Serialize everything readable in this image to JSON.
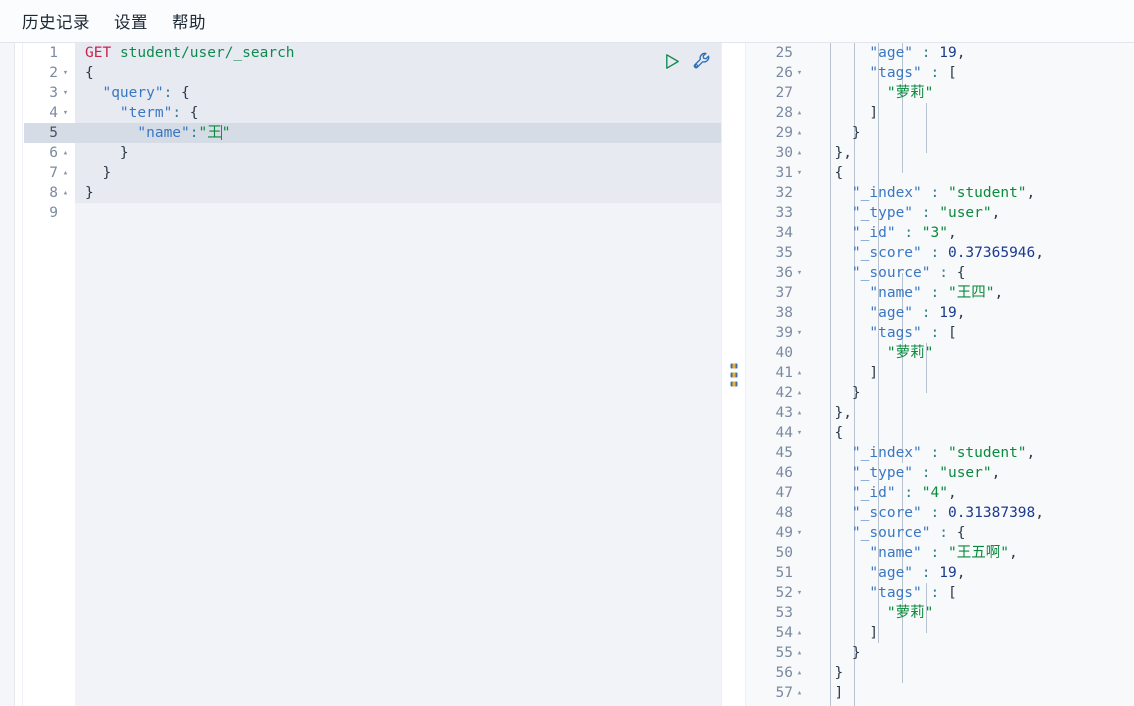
{
  "menubar": {
    "items": [
      {
        "label": "历史记录",
        "name": "menu-history"
      },
      {
        "label": "设置",
        "name": "menu-settings"
      },
      {
        "label": "帮助",
        "name": "menu-help"
      }
    ]
  },
  "editor": {
    "actions": [
      {
        "name": "run-request-button",
        "icon": "play-icon",
        "color": "#0f8a4f",
        "title": "发送请求"
      },
      {
        "name": "wrench-menu-button",
        "icon": "wrench-icon",
        "color": "#2f6fb5",
        "title": "操作菜单"
      }
    ],
    "active_line": 5,
    "request": {
      "method": "GET",
      "path": "student/user/_search",
      "query_field": "query",
      "term_field": "term",
      "name_field": "name",
      "name_value": "王"
    },
    "lines": [
      {
        "no": 1,
        "fold": "",
        "active": false,
        "lit": true,
        "tokens": [
          {
            "c": "t-method",
            "t": "GET"
          },
          {
            "c": "t-punc",
            "t": " "
          },
          {
            "c": "t-url",
            "t": "student/user/_search"
          }
        ]
      },
      {
        "no": 2,
        "fold": "▾",
        "active": false,
        "lit": true,
        "tokens": [
          {
            "c": "t-brace",
            "t": "{"
          }
        ]
      },
      {
        "no": 3,
        "fold": "▾",
        "active": false,
        "lit": true,
        "tokens": [
          {
            "c": "t-punc",
            "t": "  "
          },
          {
            "c": "t-key",
            "t": "\"query\""
          },
          {
            "c": "t-colon",
            "t": ":"
          },
          {
            "c": "t-punc",
            "t": " "
          },
          {
            "c": "t-brace",
            "t": "{"
          }
        ]
      },
      {
        "no": 4,
        "fold": "▾",
        "active": false,
        "lit": true,
        "tokens": [
          {
            "c": "t-punc",
            "t": "    "
          },
          {
            "c": "t-key",
            "t": "\"term\""
          },
          {
            "c": "t-colon",
            "t": ":"
          },
          {
            "c": "t-punc",
            "t": " "
          },
          {
            "c": "t-brace",
            "t": "{"
          }
        ]
      },
      {
        "no": 5,
        "fold": "",
        "active": true,
        "lit": true,
        "caret_after": true,
        "tokens": [
          {
            "c": "t-punc",
            "t": "      "
          },
          {
            "c": "t-key",
            "t": "\"name\""
          },
          {
            "c": "t-colon",
            "t": ":"
          },
          {
            "c": "t-str",
            "t": "\"王"
          }
        ]
      },
      {
        "no": 6,
        "fold": "▴",
        "active": false,
        "lit": true,
        "tokens": [
          {
            "c": "t-punc",
            "t": "    "
          },
          {
            "c": "t-brace",
            "t": "}"
          }
        ]
      },
      {
        "no": 7,
        "fold": "▴",
        "active": false,
        "lit": true,
        "tokens": [
          {
            "c": "t-punc",
            "t": "  "
          },
          {
            "c": "t-brace",
            "t": "}"
          }
        ]
      },
      {
        "no": 8,
        "fold": "▴",
        "active": false,
        "lit": true,
        "tokens": [
          {
            "c": "t-brace",
            "t": "}"
          }
        ]
      },
      {
        "no": 9,
        "fold": "",
        "active": false,
        "lit": false,
        "tokens": []
      }
    ]
  },
  "splitter": {
    "name": "panel-splitter",
    "handle": "drag-handle-icon"
  },
  "response": {
    "first_line": 25,
    "hits": [
      {
        "_index": "student",
        "_type": "user",
        "_id": "3",
        "_score": 0.37365946,
        "_source": {
          "name": "王四",
          "age": 19,
          "tags": [
            "萝莉"
          ]
        }
      },
      {
        "_index": "student",
        "_type": "user",
        "_id": "4",
        "_score": 0.31387398,
        "_source": {
          "name": "王五啊",
          "age": 19,
          "tags": [
            "萝莉"
          ]
        }
      }
    ],
    "lines": [
      {
        "no": 25,
        "fold": "",
        "tokens": [
          {
            "c": "t-punc",
            "t": "      "
          },
          {
            "c": "t-key",
            "t": "\"age\""
          },
          {
            "c": "t-punc",
            "t": " "
          },
          {
            "c": "t-colon",
            "t": ":"
          },
          {
            "c": "t-punc",
            "t": " "
          },
          {
            "c": "t-num",
            "t": "19"
          },
          {
            "c": "t-punc",
            "t": ","
          }
        ]
      },
      {
        "no": 26,
        "fold": "▾",
        "tokens": [
          {
            "c": "t-punc",
            "t": "      "
          },
          {
            "c": "t-key",
            "t": "\"tags\""
          },
          {
            "c": "t-punc",
            "t": " "
          },
          {
            "c": "t-colon",
            "t": ":"
          },
          {
            "c": "t-punc",
            "t": " "
          },
          {
            "c": "t-brace",
            "t": "["
          }
        ]
      },
      {
        "no": 27,
        "fold": "",
        "tokens": [
          {
            "c": "t-punc",
            "t": "        "
          },
          {
            "c": "t-str",
            "t": "\"萝莉\""
          }
        ]
      },
      {
        "no": 28,
        "fold": "▴",
        "tokens": [
          {
            "c": "t-punc",
            "t": "      "
          },
          {
            "c": "t-brace",
            "t": "]"
          }
        ]
      },
      {
        "no": 29,
        "fold": "▴",
        "tokens": [
          {
            "c": "t-punc",
            "t": "    "
          },
          {
            "c": "t-brace",
            "t": "}"
          }
        ]
      },
      {
        "no": 30,
        "fold": "▴",
        "tokens": [
          {
            "c": "t-punc",
            "t": "  "
          },
          {
            "c": "t-brace",
            "t": "}"
          },
          {
            "c": "t-punc",
            "t": ","
          }
        ]
      },
      {
        "no": 31,
        "fold": "▾",
        "tokens": [
          {
            "c": "t-punc",
            "t": "  "
          },
          {
            "c": "t-brace",
            "t": "{"
          }
        ]
      },
      {
        "no": 32,
        "fold": "",
        "tokens": [
          {
            "c": "t-punc",
            "t": "    "
          },
          {
            "c": "t-key",
            "t": "\"_index\""
          },
          {
            "c": "t-punc",
            "t": " "
          },
          {
            "c": "t-colon",
            "t": ":"
          },
          {
            "c": "t-punc",
            "t": " "
          },
          {
            "c": "t-str",
            "t": "\"student\""
          },
          {
            "c": "t-punc",
            "t": ","
          }
        ]
      },
      {
        "no": 33,
        "fold": "",
        "tokens": [
          {
            "c": "t-punc",
            "t": "    "
          },
          {
            "c": "t-key",
            "t": "\"_type\""
          },
          {
            "c": "t-punc",
            "t": " "
          },
          {
            "c": "t-colon",
            "t": ":"
          },
          {
            "c": "t-punc",
            "t": " "
          },
          {
            "c": "t-str",
            "t": "\"user\""
          },
          {
            "c": "t-punc",
            "t": ","
          }
        ]
      },
      {
        "no": 34,
        "fold": "",
        "tokens": [
          {
            "c": "t-punc",
            "t": "    "
          },
          {
            "c": "t-key",
            "t": "\"_id\""
          },
          {
            "c": "t-punc",
            "t": " "
          },
          {
            "c": "t-colon",
            "t": ":"
          },
          {
            "c": "t-punc",
            "t": " "
          },
          {
            "c": "t-str",
            "t": "\"3\""
          },
          {
            "c": "t-punc",
            "t": ","
          }
        ]
      },
      {
        "no": 35,
        "fold": "",
        "tokens": [
          {
            "c": "t-punc",
            "t": "    "
          },
          {
            "c": "t-key",
            "t": "\"_score\""
          },
          {
            "c": "t-punc",
            "t": " "
          },
          {
            "c": "t-colon",
            "t": ":"
          },
          {
            "c": "t-punc",
            "t": " "
          },
          {
            "c": "t-num",
            "t": "0.37365946"
          },
          {
            "c": "t-punc",
            "t": ","
          }
        ]
      },
      {
        "no": 36,
        "fold": "▾",
        "tokens": [
          {
            "c": "t-punc",
            "t": "    "
          },
          {
            "c": "t-key",
            "t": "\"_source\""
          },
          {
            "c": "t-punc",
            "t": " "
          },
          {
            "c": "t-colon",
            "t": ":"
          },
          {
            "c": "t-punc",
            "t": " "
          },
          {
            "c": "t-brace",
            "t": "{"
          }
        ]
      },
      {
        "no": 37,
        "fold": "",
        "tokens": [
          {
            "c": "t-punc",
            "t": "      "
          },
          {
            "c": "t-key",
            "t": "\"name\""
          },
          {
            "c": "t-punc",
            "t": " "
          },
          {
            "c": "t-colon",
            "t": ":"
          },
          {
            "c": "t-punc",
            "t": " "
          },
          {
            "c": "t-str",
            "t": "\"王四\""
          },
          {
            "c": "t-punc",
            "t": ","
          }
        ]
      },
      {
        "no": 38,
        "fold": "",
        "tokens": [
          {
            "c": "t-punc",
            "t": "      "
          },
          {
            "c": "t-key",
            "t": "\"age\""
          },
          {
            "c": "t-punc",
            "t": " "
          },
          {
            "c": "t-colon",
            "t": ":"
          },
          {
            "c": "t-punc",
            "t": " "
          },
          {
            "c": "t-num",
            "t": "19"
          },
          {
            "c": "t-punc",
            "t": ","
          }
        ]
      },
      {
        "no": 39,
        "fold": "▾",
        "tokens": [
          {
            "c": "t-punc",
            "t": "      "
          },
          {
            "c": "t-key",
            "t": "\"tags\""
          },
          {
            "c": "t-punc",
            "t": " "
          },
          {
            "c": "t-colon",
            "t": ":"
          },
          {
            "c": "t-punc",
            "t": " "
          },
          {
            "c": "t-brace",
            "t": "["
          }
        ]
      },
      {
        "no": 40,
        "fold": "",
        "tokens": [
          {
            "c": "t-punc",
            "t": "        "
          },
          {
            "c": "t-str",
            "t": "\"萝莉\""
          }
        ]
      },
      {
        "no": 41,
        "fold": "▴",
        "tokens": [
          {
            "c": "t-punc",
            "t": "      "
          },
          {
            "c": "t-brace",
            "t": "]"
          }
        ]
      },
      {
        "no": 42,
        "fold": "▴",
        "tokens": [
          {
            "c": "t-punc",
            "t": "    "
          },
          {
            "c": "t-brace",
            "t": "}"
          }
        ]
      },
      {
        "no": 43,
        "fold": "▴",
        "tokens": [
          {
            "c": "t-punc",
            "t": "  "
          },
          {
            "c": "t-brace",
            "t": "}"
          },
          {
            "c": "t-punc",
            "t": ","
          }
        ]
      },
      {
        "no": 44,
        "fold": "▾",
        "tokens": [
          {
            "c": "t-punc",
            "t": "  "
          },
          {
            "c": "t-brace",
            "t": "{"
          }
        ]
      },
      {
        "no": 45,
        "fold": "",
        "tokens": [
          {
            "c": "t-punc",
            "t": "    "
          },
          {
            "c": "t-key",
            "t": "\"_index\""
          },
          {
            "c": "t-punc",
            "t": " "
          },
          {
            "c": "t-colon",
            "t": ":"
          },
          {
            "c": "t-punc",
            "t": " "
          },
          {
            "c": "t-str",
            "t": "\"student\""
          },
          {
            "c": "t-punc",
            "t": ","
          }
        ]
      },
      {
        "no": 46,
        "fold": "",
        "tokens": [
          {
            "c": "t-punc",
            "t": "    "
          },
          {
            "c": "t-key",
            "t": "\"_type\""
          },
          {
            "c": "t-punc",
            "t": " "
          },
          {
            "c": "t-colon",
            "t": ":"
          },
          {
            "c": "t-punc",
            "t": " "
          },
          {
            "c": "t-str",
            "t": "\"user\""
          },
          {
            "c": "t-punc",
            "t": ","
          }
        ]
      },
      {
        "no": 47,
        "fold": "",
        "tokens": [
          {
            "c": "t-punc",
            "t": "    "
          },
          {
            "c": "t-key",
            "t": "\"_id\""
          },
          {
            "c": "t-punc",
            "t": " "
          },
          {
            "c": "t-colon",
            "t": ":"
          },
          {
            "c": "t-punc",
            "t": " "
          },
          {
            "c": "t-str",
            "t": "\"4\""
          },
          {
            "c": "t-punc",
            "t": ","
          }
        ]
      },
      {
        "no": 48,
        "fold": "",
        "tokens": [
          {
            "c": "t-punc",
            "t": "    "
          },
          {
            "c": "t-key",
            "t": "\"_score\""
          },
          {
            "c": "t-punc",
            "t": " "
          },
          {
            "c": "t-colon",
            "t": ":"
          },
          {
            "c": "t-punc",
            "t": " "
          },
          {
            "c": "t-num",
            "t": "0.31387398"
          },
          {
            "c": "t-punc",
            "t": ","
          }
        ]
      },
      {
        "no": 49,
        "fold": "▾",
        "tokens": [
          {
            "c": "t-punc",
            "t": "    "
          },
          {
            "c": "t-key",
            "t": "\"_source\""
          },
          {
            "c": "t-punc",
            "t": " "
          },
          {
            "c": "t-colon",
            "t": ":"
          },
          {
            "c": "t-punc",
            "t": " "
          },
          {
            "c": "t-brace",
            "t": "{"
          }
        ]
      },
      {
        "no": 50,
        "fold": "",
        "tokens": [
          {
            "c": "t-punc",
            "t": "      "
          },
          {
            "c": "t-key",
            "t": "\"name\""
          },
          {
            "c": "t-punc",
            "t": " "
          },
          {
            "c": "t-colon",
            "t": ":"
          },
          {
            "c": "t-punc",
            "t": " "
          },
          {
            "c": "t-str",
            "t": "\"王五啊\""
          },
          {
            "c": "t-punc",
            "t": ","
          }
        ]
      },
      {
        "no": 51,
        "fold": "",
        "tokens": [
          {
            "c": "t-punc",
            "t": "      "
          },
          {
            "c": "t-key",
            "t": "\"age\""
          },
          {
            "c": "t-punc",
            "t": " "
          },
          {
            "c": "t-colon",
            "t": ":"
          },
          {
            "c": "t-punc",
            "t": " "
          },
          {
            "c": "t-num",
            "t": "19"
          },
          {
            "c": "t-punc",
            "t": ","
          }
        ]
      },
      {
        "no": 52,
        "fold": "▾",
        "tokens": [
          {
            "c": "t-punc",
            "t": "      "
          },
          {
            "c": "t-key",
            "t": "\"tags\""
          },
          {
            "c": "t-punc",
            "t": " "
          },
          {
            "c": "t-colon",
            "t": ":"
          },
          {
            "c": "t-punc",
            "t": " "
          },
          {
            "c": "t-brace",
            "t": "["
          }
        ]
      },
      {
        "no": 53,
        "fold": "",
        "tokens": [
          {
            "c": "t-punc",
            "t": "        "
          },
          {
            "c": "t-str",
            "t": "\"萝莉\""
          }
        ]
      },
      {
        "no": 54,
        "fold": "▴",
        "tokens": [
          {
            "c": "t-punc",
            "t": "      "
          },
          {
            "c": "t-brace",
            "t": "]"
          }
        ]
      },
      {
        "no": 55,
        "fold": "▴",
        "tokens": [
          {
            "c": "t-punc",
            "t": "    "
          },
          {
            "c": "t-brace",
            "t": "}"
          }
        ]
      },
      {
        "no": 56,
        "fold": "▴",
        "tokens": [
          {
            "c": "t-punc",
            "t": "  "
          },
          {
            "c": "t-brace",
            "t": "}"
          }
        ]
      },
      {
        "no": 57,
        "fold": "▴",
        "tokens": [
          {
            "c": "t-punc",
            "t": "  "
          },
          {
            "c": "t-brace",
            "t": "]"
          }
        ]
      }
    ]
  }
}
